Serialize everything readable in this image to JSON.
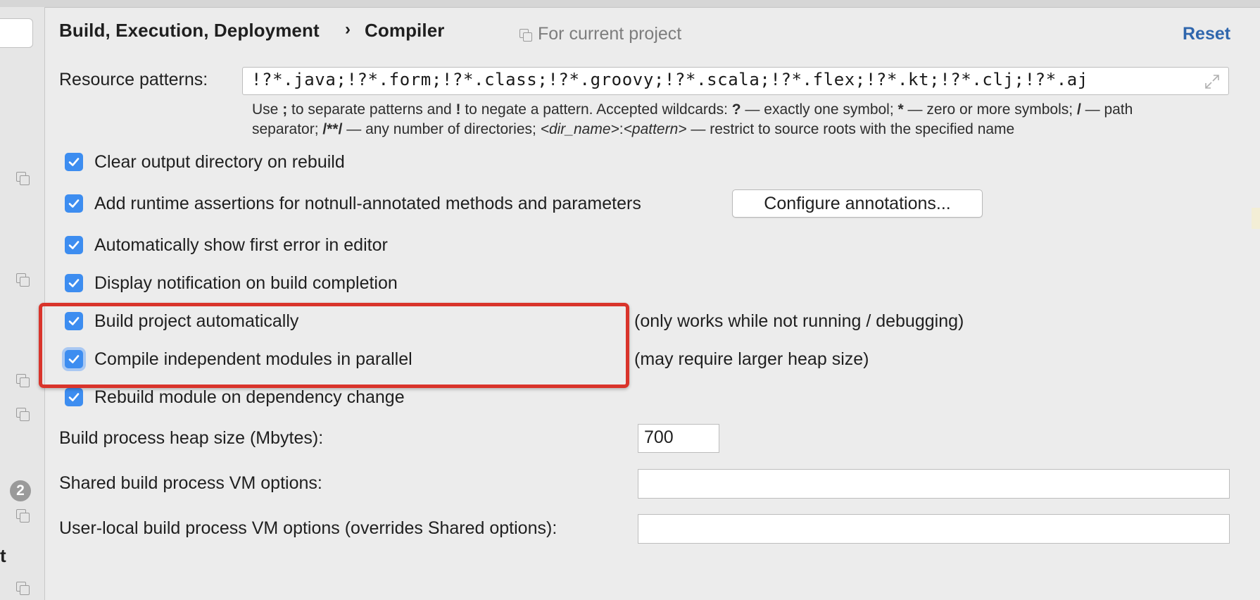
{
  "breadcrumb": {
    "parent": "Build, Execution, Deployment",
    "separator": "›",
    "current": "Compiler"
  },
  "scope_label": "For current project",
  "reset_label": "Reset",
  "resource_patterns": {
    "label": "Resource patterns:",
    "value": "!?*.java;!?*.form;!?*.class;!?*.groovy;!?*.scala;!?*.flex;!?*.kt;!?*.clj;!?*.aj",
    "hint_line1_parts": [
      "Use ",
      ";",
      " to separate patterns and ",
      "!",
      " to negate a pattern. Accepted wildcards: ",
      "?",
      " — exactly one symbol; ",
      "*",
      " — zero or more symbols; ",
      "/",
      " — path"
    ],
    "hint_line2_parts": [
      "separator; ",
      "/**/",
      " — any number of directories; ",
      "<dir_name>",
      ":",
      "<pattern>",
      " — restrict to source roots with the specified name"
    ]
  },
  "options": [
    {
      "label": "Clear output directory on rebuild",
      "checked": true
    },
    {
      "label": "Add runtime assertions for notnull-annotated methods and parameters",
      "checked": true,
      "button": "Configure annotations..."
    },
    {
      "label": "Automatically show first error in editor",
      "checked": true
    },
    {
      "label": "Display notification on build completion",
      "checked": true
    },
    {
      "label": "Build project automatically",
      "checked": true,
      "note": "(only works while not running / debugging)"
    },
    {
      "label": "Compile independent modules in parallel",
      "checked": true,
      "note": "(may require larger heap size)"
    },
    {
      "label": "Rebuild module on dependency change",
      "checked": true
    }
  ],
  "heap": {
    "label": "Build process heap size (Mbytes):",
    "value": "700"
  },
  "shared_vm": {
    "label": "Shared build process VM options:",
    "value": ""
  },
  "local_vm": {
    "label": "User-local build process VM options (overrides Shared options):",
    "value": ""
  },
  "left_pane": {
    "badge_count": "2",
    "partial_letter": "t"
  },
  "colors": {
    "accent": "#3d8df0",
    "link": "#2f66ad",
    "highlight_border": "#d9342b"
  }
}
